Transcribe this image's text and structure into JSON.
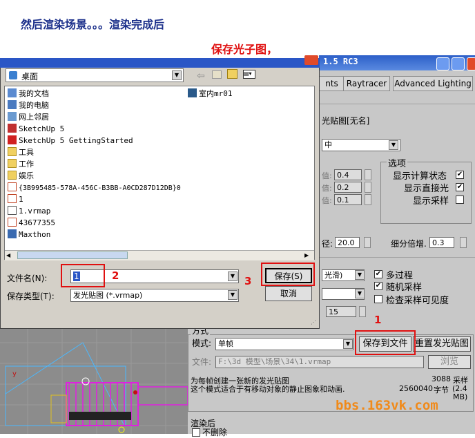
{
  "heading": "然后渲染场景。。。渲染完成后",
  "note": "保存光子图，",
  "watermark": "bbs.163vk.com",
  "max_window": {
    "title": "1.5 RC3",
    "tabs": [
      "nts",
      "Raytracer",
      "Advanced Lighting"
    ],
    "map_label": "光贴图[无名]",
    "preset_value": "中",
    "options_group": "选项",
    "spinners": [
      {
        "prefix": "值:",
        "value": "0.4"
      },
      {
        "prefix": "值:",
        "value": "0.2"
      },
      {
        "prefix": "值:",
        "value": "0.1"
      }
    ],
    "options": [
      {
        "label": "显示计算状态",
        "checked": true
      },
      {
        "label": "显示直接光",
        "checked": true
      },
      {
        "label": "显示采样",
        "checked": false
      }
    ],
    "radius_label": "径:",
    "radius_value": "20.0",
    "subdiv_label": "细分倍增.",
    "subdiv_value": "0.3",
    "interp_value": "光滑)",
    "checks2": [
      {
        "label": "多过程",
        "checked": true
      },
      {
        "label": "随机采样",
        "checked": true
      },
      {
        "label": "检查采样可见度",
        "checked": false
      }
    ],
    "spin15": "15",
    "section_mode": "方式",
    "mode_label": "模式:",
    "mode_value": "单帧",
    "save_to_file": "保存到文件",
    "reset_map": "重置发光贴图",
    "file_label": "文件:",
    "file_path": "F:\\3d  模型\\场景\\34\\1.vrmap",
    "browse": "浏览",
    "desc_line1": "为每帧创建一张新的发光贴图",
    "desc_line2": "这个模式适合于有移动对象的静止图象和动画.",
    "stats_samples_num": "3088",
    "stats_samples_label": "采样",
    "stats_bytes_num": "2560040",
    "stats_bytes_label": "字节",
    "stats_mb": "(2.4",
    "stats_mb2": "MB)",
    "after_render": "渲染后",
    "no_delete": "不删除"
  },
  "dialog": {
    "location": "桌面",
    "files": [
      {
        "name": "我的文档",
        "icon": "my-documents-icon"
      },
      {
        "name": "我的电脑",
        "icon": "my-computer-icon"
      },
      {
        "name": "网上邻居",
        "icon": "network-icon"
      },
      {
        "name": "SketchUp 5",
        "icon": "sketchup-icon"
      },
      {
        "name": "SketchUp 5 GettingStarted",
        "icon": "sketchup-getting-started-icon"
      },
      {
        "name": "工具",
        "icon": "folder-icon"
      },
      {
        "name": "工作",
        "icon": "folder-icon"
      },
      {
        "name": "娱乐",
        "icon": "folder-icon"
      },
      {
        "name": "{3B995485-578A-456C-B3BB-A0CD287D12DB}0",
        "icon": "file-icon"
      },
      {
        "name": "1",
        "icon": "file-icon"
      },
      {
        "name": "1.vrmap",
        "icon": "vrmap-file-icon"
      },
      {
        "name": "43677355",
        "icon": "file-icon"
      },
      {
        "name": "Maxthon",
        "icon": "maxthon-icon"
      }
    ],
    "right_file": {
      "name": "室内mr01",
      "icon": "max-scene-icon"
    },
    "filename_label": "文件名(N):",
    "filename_value": "1",
    "filetype_label": "保存类型(T):",
    "filetype_value": "发光贴图 (*.vrmap)",
    "save_button": "保存(S)",
    "cancel_button": "取消"
  },
  "markers": {
    "one": "1",
    "two": "2",
    "three": "3"
  }
}
